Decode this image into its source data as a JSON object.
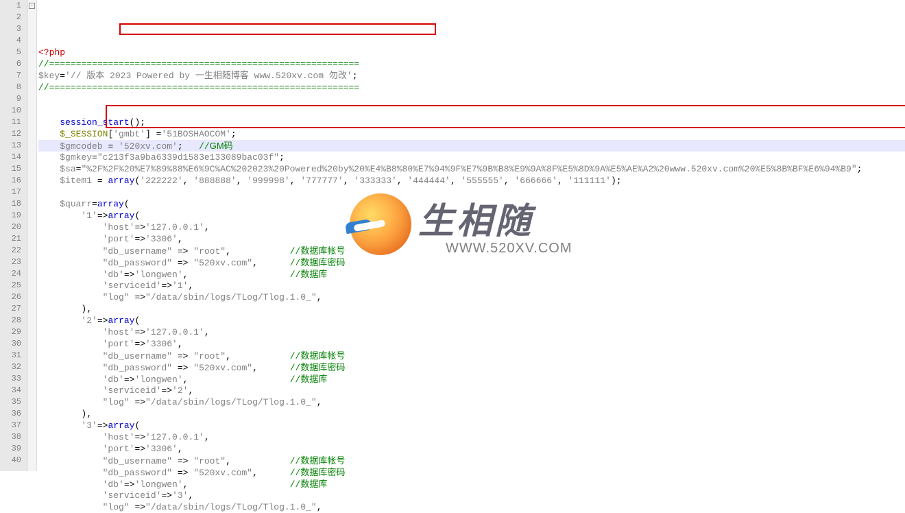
{
  "watermark": {
    "cn": "生相随",
    "url": "WWW.520XV.COM"
  },
  "fold_markers": {
    "1": "minus"
  },
  "highlight_line": 9,
  "lines": {
    "1": [
      {
        "t": "<?",
        "c": "k-red"
      },
      {
        "t": "php",
        "c": "k-red"
      }
    ],
    "2": [
      {
        "t": "//==========================================================",
        "c": "k-green"
      }
    ],
    "3": [
      {
        "t": "$key",
        "c": "k-gray"
      },
      {
        "t": "=",
        "c": ""
      },
      {
        "t": "'",
        "c": "k-gray"
      },
      {
        "t": "// 版本 2023 Powered by 一生相随博客 www.520xv.com 勿改",
        "c": "k-gray"
      },
      {
        "t": "'",
        "c": "k-gray"
      },
      {
        "t": ";",
        "c": ""
      }
    ],
    "4": [
      {
        "t": "//==========================================================",
        "c": "k-green"
      }
    ],
    "5": [],
    "6": [],
    "7": [
      {
        "t": "    ",
        "c": ""
      },
      {
        "t": "session_start",
        "c": "k-blue"
      },
      {
        "t": "();",
        "c": ""
      }
    ],
    "8": [
      {
        "t": "    ",
        "c": ""
      },
      {
        "t": "$_SESSION",
        "c": "k-olive"
      },
      {
        "t": "[",
        "c": ""
      },
      {
        "t": "'gmbt'",
        "c": "k-gray"
      },
      {
        "t": "] =",
        "c": ""
      },
      {
        "t": "'51BOSHAOCOM'",
        "c": "k-gray"
      },
      {
        "t": ";",
        "c": ""
      }
    ],
    "9": [
      {
        "t": "    ",
        "c": ""
      },
      {
        "t": "$gmcodeb",
        "c": "k-gray"
      },
      {
        "t": " = ",
        "c": ""
      },
      {
        "t": "'520xv.com'",
        "c": "k-gray"
      },
      {
        "t": ";   ",
        "c": ""
      },
      {
        "t": "//",
        "c": "k-green"
      },
      {
        "t": "GM码",
        "c": "k-cjk-green"
      }
    ],
    "10": [
      {
        "t": "    ",
        "c": ""
      },
      {
        "t": "$gmkey",
        "c": "k-gray"
      },
      {
        "t": "=",
        "c": ""
      },
      {
        "t": "\"c213f3a9ba6339d1583e133089bac03f\"",
        "c": "k-gray"
      },
      {
        "t": ";",
        "c": ""
      }
    ],
    "11": [
      {
        "t": "    ",
        "c": ""
      },
      {
        "t": "$sa",
        "c": "k-gray"
      },
      {
        "t": "=",
        "c": ""
      },
      {
        "t": "\"%2F%2F%20%E7%89%88%E6%9C%AC%202023%20Powered%20by%20%E4%B8%80%E7%94%9F%E7%9B%B8%E9%9A%8F%E5%8D%9A%E5%AE%A2%20www.520xv.com%20%E5%8B%BF%E6%94%B9\"",
        "c": "k-gray"
      },
      {
        "t": ";",
        "c": ""
      }
    ],
    "12": [
      {
        "t": "    ",
        "c": ""
      },
      {
        "t": "$item1",
        "c": "k-gray"
      },
      {
        "t": " = ",
        "c": ""
      },
      {
        "t": "array",
        "c": "k-blue"
      },
      {
        "t": "(",
        "c": ""
      },
      {
        "t": "'222222'",
        "c": "k-gray"
      },
      {
        "t": ", ",
        "c": ""
      },
      {
        "t": "'888888'",
        "c": "k-gray"
      },
      {
        "t": ", ",
        "c": ""
      },
      {
        "t": "'999998'",
        "c": "k-gray"
      },
      {
        "t": ", ",
        "c": ""
      },
      {
        "t": "'777777'",
        "c": "k-gray"
      },
      {
        "t": ", ",
        "c": ""
      },
      {
        "t": "'333333'",
        "c": "k-gray"
      },
      {
        "t": ", ",
        "c": ""
      },
      {
        "t": "'444444'",
        "c": "k-gray"
      },
      {
        "t": ", ",
        "c": ""
      },
      {
        "t": "'555555'",
        "c": "k-gray"
      },
      {
        "t": ", ",
        "c": ""
      },
      {
        "t": "'666666'",
        "c": "k-gray"
      },
      {
        "t": ", ",
        "c": ""
      },
      {
        "t": "'111111'",
        "c": "k-gray"
      },
      {
        "t": ");",
        "c": ""
      }
    ],
    "13": [],
    "14": [
      {
        "t": "    ",
        "c": ""
      },
      {
        "t": "$quarr",
        "c": "k-gray"
      },
      {
        "t": "=",
        "c": ""
      },
      {
        "t": "array",
        "c": "k-blue"
      },
      {
        "t": "(",
        "c": ""
      }
    ],
    "15": [
      {
        "t": "        ",
        "c": ""
      },
      {
        "t": "'1'",
        "c": "k-gray"
      },
      {
        "t": "=>",
        "c": ""
      },
      {
        "t": "array",
        "c": "k-blue"
      },
      {
        "t": "(",
        "c": ""
      }
    ],
    "16": [
      {
        "t": "            ",
        "c": ""
      },
      {
        "t": "'host'",
        "c": "k-gray"
      },
      {
        "t": "=>",
        "c": ""
      },
      {
        "t": "'127.0.0.1'",
        "c": "k-gray"
      },
      {
        "t": ",",
        "c": ""
      }
    ],
    "17": [
      {
        "t": "            ",
        "c": ""
      },
      {
        "t": "'port'",
        "c": "k-gray"
      },
      {
        "t": "=>",
        "c": ""
      },
      {
        "t": "'3306'",
        "c": "k-gray"
      },
      {
        "t": ",",
        "c": ""
      }
    ],
    "18": [
      {
        "t": "            ",
        "c": ""
      },
      {
        "t": "\"db_username\"",
        "c": "k-gray"
      },
      {
        "t": " => ",
        "c": ""
      },
      {
        "t": "\"root\"",
        "c": "k-gray"
      },
      {
        "t": ",           ",
        "c": ""
      },
      {
        "t": "//",
        "c": "k-green"
      },
      {
        "t": "数据库帐号",
        "c": "k-cjk-green"
      }
    ],
    "19": [
      {
        "t": "            ",
        "c": ""
      },
      {
        "t": "\"db_password\"",
        "c": "k-gray"
      },
      {
        "t": " => ",
        "c": ""
      },
      {
        "t": "\"520xv.com\"",
        "c": "k-gray"
      },
      {
        "t": ",      ",
        "c": ""
      },
      {
        "t": "//",
        "c": "k-green"
      },
      {
        "t": "数据库密码",
        "c": "k-cjk-green"
      }
    ],
    "20": [
      {
        "t": "            ",
        "c": ""
      },
      {
        "t": "'db'",
        "c": "k-gray"
      },
      {
        "t": "=>",
        "c": ""
      },
      {
        "t": "'longwen'",
        "c": "k-gray"
      },
      {
        "t": ",                   ",
        "c": ""
      },
      {
        "t": "//",
        "c": "k-green"
      },
      {
        "t": "数据库",
        "c": "k-cjk-green"
      }
    ],
    "21": [
      {
        "t": "            ",
        "c": ""
      },
      {
        "t": "'serviceid'",
        "c": "k-gray"
      },
      {
        "t": "=>",
        "c": ""
      },
      {
        "t": "'1'",
        "c": "k-gray"
      },
      {
        "t": ",",
        "c": ""
      }
    ],
    "22": [
      {
        "t": "            ",
        "c": ""
      },
      {
        "t": "\"log\"",
        "c": "k-gray"
      },
      {
        "t": " =>",
        "c": ""
      },
      {
        "t": "\"/data/sbin/logs/TLog/Tlog.1.0_\"",
        "c": "k-gray"
      },
      {
        "t": ",",
        "c": ""
      }
    ],
    "23": [
      {
        "t": "        ),",
        "c": ""
      }
    ],
    "24": [
      {
        "t": "        ",
        "c": ""
      },
      {
        "t": "'2'",
        "c": "k-gray"
      },
      {
        "t": "=>",
        "c": ""
      },
      {
        "t": "array",
        "c": "k-blue"
      },
      {
        "t": "(",
        "c": ""
      }
    ],
    "25": [
      {
        "t": "            ",
        "c": ""
      },
      {
        "t": "'host'",
        "c": "k-gray"
      },
      {
        "t": "=>",
        "c": ""
      },
      {
        "t": "'127.0.0.1'",
        "c": "k-gray"
      },
      {
        "t": ",",
        "c": ""
      }
    ],
    "26": [
      {
        "t": "            ",
        "c": ""
      },
      {
        "t": "'port'",
        "c": "k-gray"
      },
      {
        "t": "=>",
        "c": ""
      },
      {
        "t": "'3306'",
        "c": "k-gray"
      },
      {
        "t": ",",
        "c": ""
      }
    ],
    "27": [
      {
        "t": "            ",
        "c": ""
      },
      {
        "t": "\"db_username\"",
        "c": "k-gray"
      },
      {
        "t": " => ",
        "c": ""
      },
      {
        "t": "\"root\"",
        "c": "k-gray"
      },
      {
        "t": ",           ",
        "c": ""
      },
      {
        "t": "//",
        "c": "k-green"
      },
      {
        "t": "数据库帐号",
        "c": "k-cjk-green"
      }
    ],
    "28": [
      {
        "t": "            ",
        "c": ""
      },
      {
        "t": "\"db_password\"",
        "c": "k-gray"
      },
      {
        "t": " => ",
        "c": ""
      },
      {
        "t": "\"520xv.com\"",
        "c": "k-gray"
      },
      {
        "t": ",      ",
        "c": ""
      },
      {
        "t": "//",
        "c": "k-green"
      },
      {
        "t": "数据库密码",
        "c": "k-cjk-green"
      }
    ],
    "29": [
      {
        "t": "            ",
        "c": ""
      },
      {
        "t": "'db'",
        "c": "k-gray"
      },
      {
        "t": "=>",
        "c": ""
      },
      {
        "t": "'longwen'",
        "c": "k-gray"
      },
      {
        "t": ",                   ",
        "c": ""
      },
      {
        "t": "//",
        "c": "k-green"
      },
      {
        "t": "数据库",
        "c": "k-cjk-green"
      }
    ],
    "30": [
      {
        "t": "            ",
        "c": ""
      },
      {
        "t": "'serviceid'",
        "c": "k-gray"
      },
      {
        "t": "=>",
        "c": ""
      },
      {
        "t": "'2'",
        "c": "k-gray"
      },
      {
        "t": ",",
        "c": ""
      }
    ],
    "31": [
      {
        "t": "            ",
        "c": ""
      },
      {
        "t": "\"log\"",
        "c": "k-gray"
      },
      {
        "t": " =>",
        "c": ""
      },
      {
        "t": "\"/data/sbin/logs/TLog/Tlog.1.0_\"",
        "c": "k-gray"
      },
      {
        "t": ",",
        "c": ""
      }
    ],
    "32": [
      {
        "t": "        ),",
        "c": ""
      }
    ],
    "33": [
      {
        "t": "        ",
        "c": ""
      },
      {
        "t": "'3'",
        "c": "k-gray"
      },
      {
        "t": "=>",
        "c": ""
      },
      {
        "t": "array",
        "c": "k-blue"
      },
      {
        "t": "(",
        "c": ""
      }
    ],
    "34": [
      {
        "t": "            ",
        "c": ""
      },
      {
        "t": "'host'",
        "c": "k-gray"
      },
      {
        "t": "=>",
        "c": ""
      },
      {
        "t": "'127.0.0.1'",
        "c": "k-gray"
      },
      {
        "t": ",",
        "c": ""
      }
    ],
    "35": [
      {
        "t": "            ",
        "c": ""
      },
      {
        "t": "'port'",
        "c": "k-gray"
      },
      {
        "t": "=>",
        "c": ""
      },
      {
        "t": "'3306'",
        "c": "k-gray"
      },
      {
        "t": ",",
        "c": ""
      }
    ],
    "36": [
      {
        "t": "            ",
        "c": ""
      },
      {
        "t": "\"db_username\"",
        "c": "k-gray"
      },
      {
        "t": " => ",
        "c": ""
      },
      {
        "t": "\"root\"",
        "c": "k-gray"
      },
      {
        "t": ",           ",
        "c": ""
      },
      {
        "t": "//",
        "c": "k-green"
      },
      {
        "t": "数据库帐号",
        "c": "k-cjk-green"
      }
    ],
    "37": [
      {
        "t": "            ",
        "c": ""
      },
      {
        "t": "\"db_password\"",
        "c": "k-gray"
      },
      {
        "t": " => ",
        "c": ""
      },
      {
        "t": "\"520xv.com\"",
        "c": "k-gray"
      },
      {
        "t": ",      ",
        "c": ""
      },
      {
        "t": "//",
        "c": "k-green"
      },
      {
        "t": "数据库密码",
        "c": "k-cjk-green"
      }
    ],
    "38": [
      {
        "t": "            ",
        "c": ""
      },
      {
        "t": "'db'",
        "c": "k-gray"
      },
      {
        "t": "=>",
        "c": ""
      },
      {
        "t": "'longwen'",
        "c": "k-gray"
      },
      {
        "t": ",                   ",
        "c": ""
      },
      {
        "t": "//",
        "c": "k-green"
      },
      {
        "t": "数据库",
        "c": "k-cjk-green"
      }
    ],
    "39": [
      {
        "t": "            ",
        "c": ""
      },
      {
        "t": "'serviceid'",
        "c": "k-gray"
      },
      {
        "t": "=>",
        "c": ""
      },
      {
        "t": "'3'",
        "c": "k-gray"
      },
      {
        "t": ",",
        "c": ""
      }
    ],
    "40": [
      {
        "t": "            ",
        "c": ""
      },
      {
        "t": "\"log\"",
        "c": "k-gray"
      },
      {
        "t": " =>",
        "c": ""
      },
      {
        "t": "\"/data/sbin/logs/TLog/Tlog.1.0_\"",
        "c": "k-gray"
      },
      {
        "t": ",",
        "c": ""
      }
    ]
  },
  "total_lines": 40
}
